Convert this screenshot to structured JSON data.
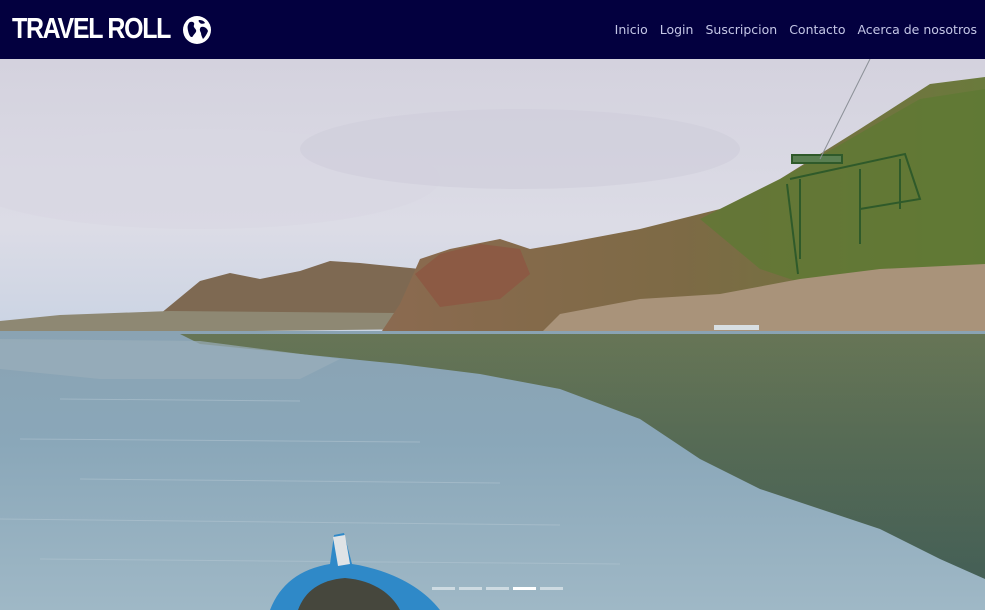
{
  "brand": {
    "name": "TRAVEL ROLL",
    "icon": "globe-icon"
  },
  "nav": {
    "items": [
      {
        "label": "Inicio"
      },
      {
        "label": "Login"
      },
      {
        "label": "Suscripcion"
      },
      {
        "label": "Contacto"
      },
      {
        "label": "Acerca de nosotros"
      }
    ]
  },
  "carousel": {
    "slide_count": 5,
    "active_slide": 4
  },
  "colors": {
    "navbar_bg": "#03003f",
    "nav_link": "#c4c6e6",
    "brand_text": "#ffffff"
  }
}
